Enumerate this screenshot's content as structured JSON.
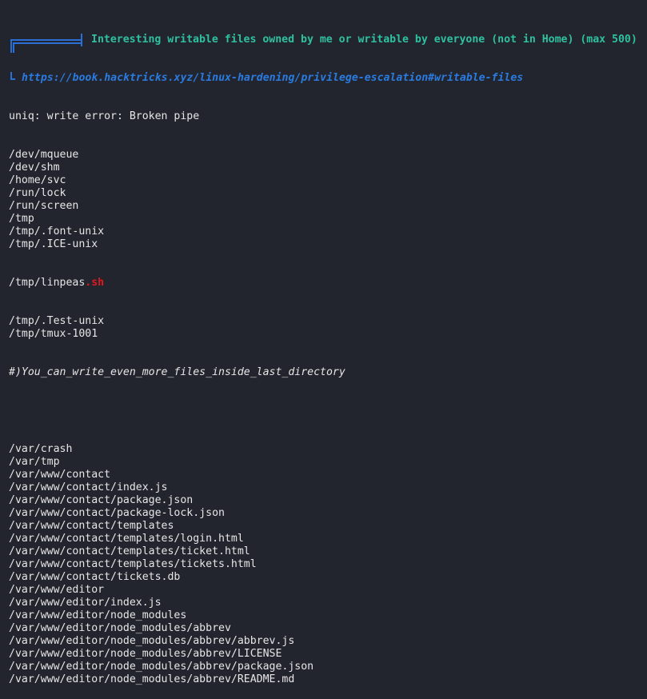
{
  "section": {
    "title": "Interesting writable files owned by me or writable by everyone (not in Home) (max 500)",
    "link": "https://book.hacktricks.xyz/linux-hardening/privilege-escalation#writable-files"
  },
  "error_line": "uniq: write error: Broken pipe",
  "paths_group1": [
    "/dev/mqueue",
    "/dev/shm",
    "/home/svc",
    "/run/lock",
    "/run/screen",
    "/tmp",
    "/tmp/.font-unix",
    "/tmp/.ICE-unix"
  ],
  "linpeas": {
    "prefix": "/tmp/linpeas",
    "suffix": ".sh"
  },
  "paths_group2": [
    "/tmp/.Test-unix",
    "/tmp/tmux-1001"
  ],
  "hint": "#)You_can_write_even_more_files_inside_last_directory",
  "paths_group3": [
    "/var/crash",
    "/var/tmp",
    "/var/www/contact",
    "/var/www/contact/index.js",
    "/var/www/contact/package.json",
    "/var/www/contact/package-lock.json",
    "/var/www/contact/templates",
    "/var/www/contact/templates/login.html",
    "/var/www/contact/templates/ticket.html",
    "/var/www/contact/templates/tickets.html",
    "/var/www/contact/tickets.db",
    "/var/www/editor",
    "/var/www/editor/index.js",
    "/var/www/editor/node_modules",
    "/var/www/editor/node_modules/abbrev",
    "/var/www/editor/node_modules/abbrev/abbrev.js",
    "/var/www/editor/node_modules/abbrev/LICENSE",
    "/var/www/editor/node_modules/abbrev/package.json",
    "/var/www/editor/node_modules/abbrev/README.md"
  ],
  "colors": {
    "background": "#23252e",
    "text": "#e6e6e6",
    "section_title": "#2fc0a0",
    "link": "#2a7be0",
    "box_drawing": "#2a6fd6",
    "highlight_red": "#e0191f"
  }
}
